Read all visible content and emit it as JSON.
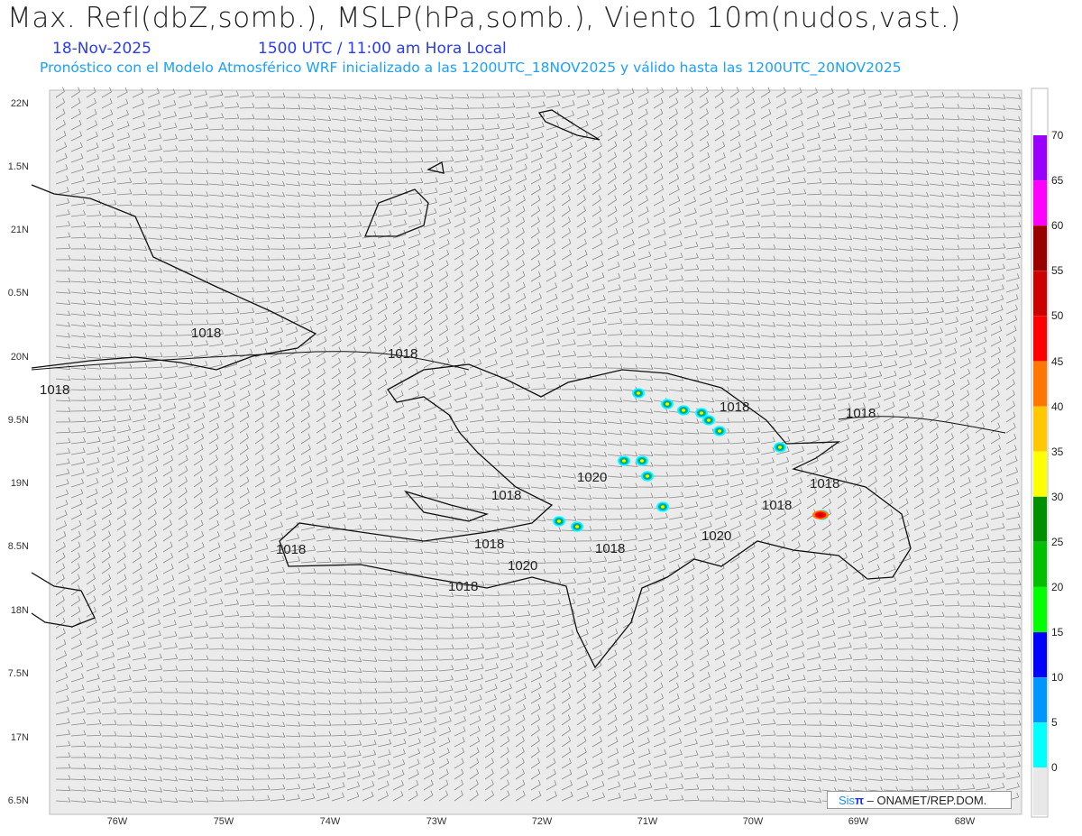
{
  "header": {
    "title": "Max. Refl(dbZ,somb.), MSLP(hPa,somb.), Viento 10m(nudos,vast.)",
    "date": "18-Nov-2025",
    "time": "1500 UTC / 11:00 am Hora Local",
    "description": "Pronóstico con el Modelo Atmosférico WRF inicializado a las 1200UTC_18NOV2025 y válido hasta las  1200UTC_20NOV2025"
  },
  "axes": {
    "lat_labels": [
      "22N",
      "1.5N",
      "21N",
      "0.5N",
      "20N",
      "9.5N",
      "19N",
      "8.5N",
      "18N",
      "7.5N",
      "17N",
      "6.5N"
    ],
    "lon_labels": [
      "76W",
      "75W",
      "74W",
      "73W",
      "72W",
      "71W",
      "70W",
      "69W",
      "68W"
    ]
  },
  "isobars": {
    "labels": [
      "1018",
      "1018",
      "1018",
      "1018",
      "1018",
      "1018",
      "1018",
      "1020",
      "1018",
      "1018",
      "1018",
      "1020",
      "1018",
      "1020",
      "1018"
    ]
  },
  "colorbar": {
    "labels": [
      "70",
      "65",
      "60",
      "55",
      "50",
      "45",
      "40",
      "35",
      "30",
      "25",
      "20",
      "15",
      "10",
      "5",
      "0"
    ],
    "colors": [
      "#9900ff",
      "#ff00ff",
      "#990000",
      "#cc0000",
      "#ff0000",
      "#ff7700",
      "#ffc800",
      "#ffff00",
      "#009000",
      "#00c000",
      "#00ff00",
      "#0000ff",
      "#0096ff",
      "#00ffff"
    ],
    "top_color": "#ffffff",
    "bottom_color": "#e8e8e8"
  },
  "credit": {
    "sis": "Sis",
    "pi": "π",
    "org": " –  ONAMET/REP.DOM."
  }
}
